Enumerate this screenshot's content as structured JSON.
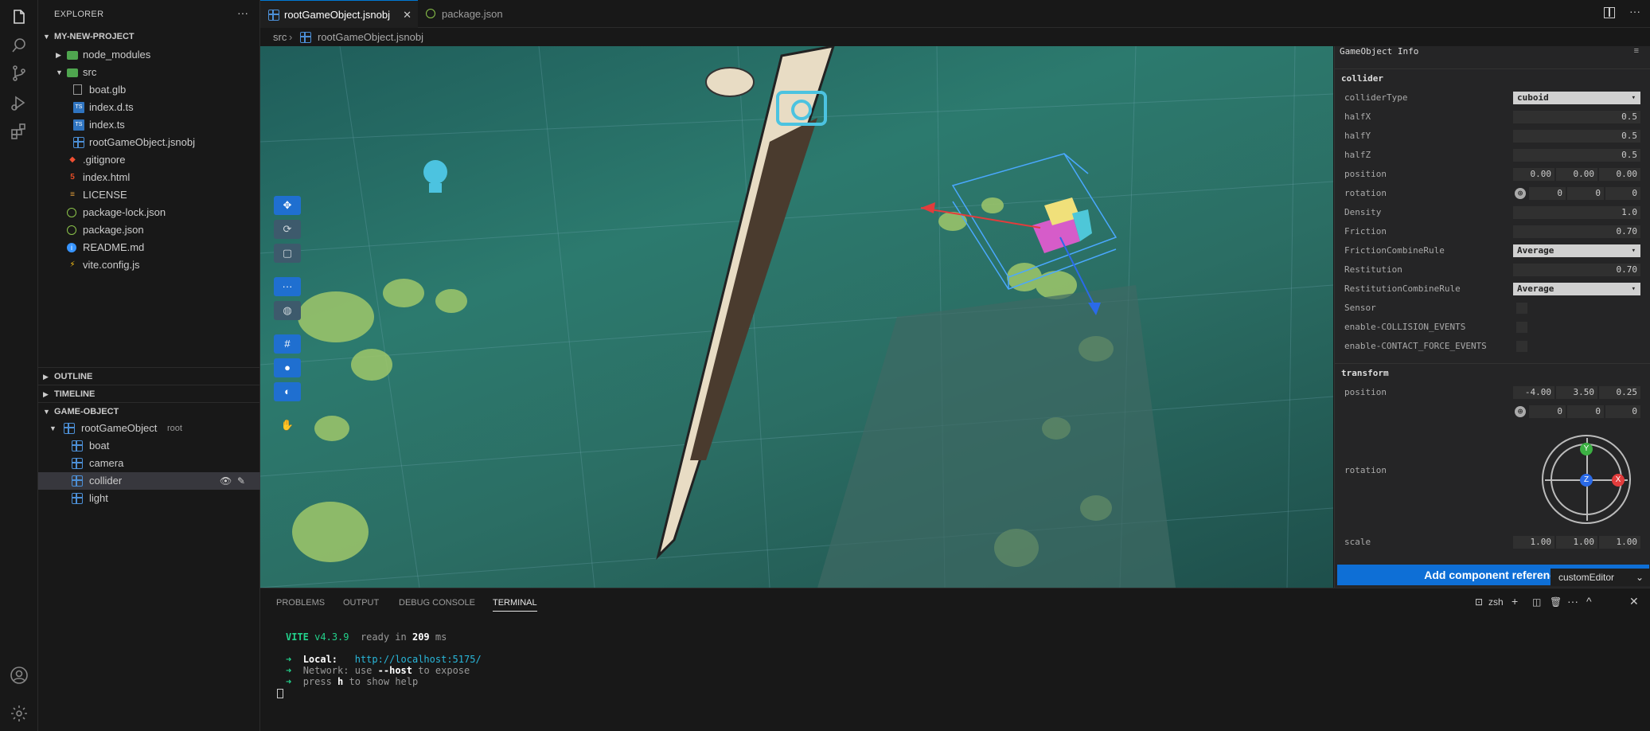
{
  "activity_bar": {
    "items": [
      "explorer-icon",
      "search-icon",
      "source-control-icon",
      "run-debug-icon",
      "extensions-icon"
    ],
    "bottom": [
      "account-icon",
      "settings-gear-icon"
    ]
  },
  "sidebar": {
    "title": "EXPLORER",
    "more": "···",
    "project": "MY-NEW-PROJECT",
    "files": [
      {
        "label": "node_modules"
      },
      {
        "label": "src"
      },
      {
        "label": "boat.glb"
      },
      {
        "label": "index.d.ts"
      },
      {
        "label": "index.ts"
      },
      {
        "label": "rootGameObject.jsnobj"
      },
      {
        "label": ".gitignore"
      },
      {
        "label": "index.html"
      },
      {
        "label": "LICENSE"
      },
      {
        "label": "package-lock.json"
      },
      {
        "label": "package.json"
      },
      {
        "label": "README.md"
      },
      {
        "label": "vite.config.js"
      }
    ],
    "outline": "OUTLINE",
    "timeline": "TIMELINE",
    "gameobject": "GAME-OBJECT",
    "go_root": "rootGameObject",
    "go_root_tag": "root",
    "go_children": [
      "boat",
      "camera",
      "collider",
      "light"
    ]
  },
  "editor_tabs": [
    {
      "label": "rootGameObject.jsnobj"
    },
    {
      "label": "package.json"
    }
  ],
  "breadcrumb": {
    "folder": "src",
    "file": "rootGameObject.jsnobj"
  },
  "viewport": {
    "tools": [
      "✥",
      "⟳",
      "▢",
      "···",
      "◍",
      "#",
      "●",
      "◐",
      "✋"
    ]
  },
  "panel": {
    "title": "GameObject Info",
    "collider_header": "collider",
    "rows": {
      "colliderType": {
        "label": "colliderType",
        "value": "cuboid"
      },
      "halfX": {
        "label": "halfX",
        "value": "0.5"
      },
      "halfY": {
        "label": "halfY",
        "value": "0.5"
      },
      "halfZ": {
        "label": "halfZ",
        "value": "0.5"
      },
      "position": {
        "label": "position",
        "v1": "0.00",
        "v2": "0.00",
        "v3": "0.00"
      },
      "rotation": {
        "label": "rotation",
        "v1": "0",
        "v2": "0",
        "v3": "0"
      },
      "density": {
        "label": "Density",
        "value": "1.0"
      },
      "friction": {
        "label": "Friction",
        "value": "0.70"
      },
      "frictionRule": {
        "label": "FrictionCombineRule",
        "value": "Average"
      },
      "restitution": {
        "label": "Restitution",
        "value": "0.70"
      },
      "restitutionRule": {
        "label": "RestitutionCombineRule",
        "value": "Average"
      },
      "sensor": {
        "label": "Sensor"
      },
      "collisionEvents": {
        "label": "enable-COLLISION_EVENTS"
      },
      "contactEvents": {
        "label": "enable-CONTACT_FORCE_EVENTS"
      }
    },
    "transform_header": "transform",
    "transform": {
      "position": {
        "label": "position",
        "v1": "-4.00",
        "v2": "3.50",
        "v3": "0.25"
      },
      "rot_values": {
        "v1": "0",
        "v2": "0",
        "v3": "0"
      },
      "rotation": {
        "label": "rotation"
      },
      "gizmo": {
        "y": "Y",
        "z": "Z",
        "x": "X"
      },
      "scale": {
        "label": "scale",
        "v1": "1.00",
        "v2": "1.00",
        "v3": "1.00"
      }
    },
    "add_button": "Add component reference",
    "custom_editor": "customEditor"
  },
  "bottom_panel": {
    "tabs": [
      "PROBLEMS",
      "OUTPUT",
      "DEBUG CONSOLE",
      "TERMINAL"
    ],
    "shell": "zsh",
    "terminal": {
      "vite": "VITE",
      "version": "v4.3.9",
      "ready": "ready in",
      "ms_value": "209",
      "ms": "ms",
      "local_label": "Local:",
      "local_url": "http://localhost:5175/",
      "network_label": "Network:",
      "network_text": "use",
      "network_flag": "--host",
      "network_tail": "to expose",
      "help_a": "press",
      "help_key": "h",
      "help_b": "to show help"
    }
  },
  "colors": {
    "accent": "#0078d4",
    "button": "#0e6fd6",
    "background": "#181818",
    "panel": "#252526"
  }
}
